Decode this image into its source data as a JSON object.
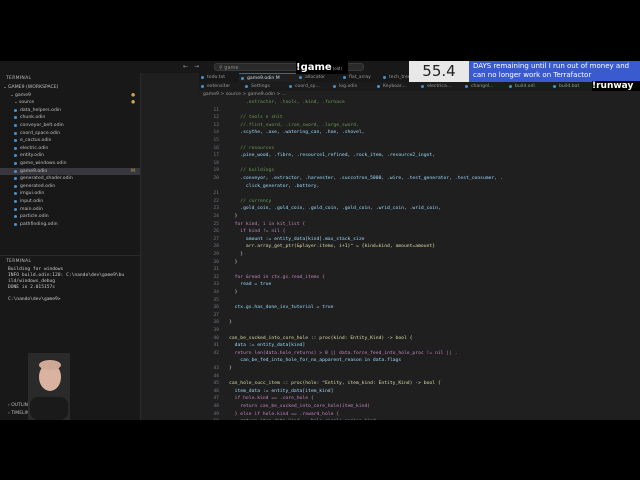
{
  "titlebar": {
    "search": "game",
    "search_icon": "magnifier-icon"
  },
  "sidebar": {
    "header": "TERMINAL",
    "workspace": "GAME9 (WORKSPACE)",
    "folder": "game9",
    "subfolder": "source",
    "files": [
      {
        "name": "data_helpers.odin",
        "mod": ""
      },
      {
        "name": "chunk.odin",
        "mod": ""
      },
      {
        "name": "conveyor_belt.odin",
        "mod": ""
      },
      {
        "name": "coord_space.odin",
        "mod": ""
      },
      {
        "name": "e_cactus.odin",
        "mod": ""
      },
      {
        "name": "electric.odin",
        "mod": ""
      },
      {
        "name": "entity.odin",
        "mod": ""
      },
      {
        "name": "game_windows.odin",
        "mod": ""
      },
      {
        "name": "game9.odin",
        "mod": "M"
      },
      {
        "name": "generated_shader.odin",
        "mod": ""
      },
      {
        "name": "generated.odin",
        "mod": ""
      },
      {
        "name": "imgui.odin",
        "mod": ""
      },
      {
        "name": "input.odin",
        "mod": ""
      },
      {
        "name": "main.odin",
        "mod": ""
      },
      {
        "name": "particle.odin",
        "mod": ""
      },
      {
        "name": "pathfinding.odin",
        "mod": ""
      }
    ],
    "folder_mod": "M",
    "subfolder_mod": "M"
  },
  "terminal": {
    "title": "TERMINAL",
    "lines": [
      "Building for windows",
      "INFO build.odin:120: C:\\nando\\dev\\game9\\bu",
      "ild/windows_debug",
      "DONE in 2.015157s",
      "",
      "C:\\nando\\dev\\game9>"
    ]
  },
  "bottom": {
    "outline": "OUTLINE",
    "timeline": "TIMELINE"
  },
  "tabs": [
    {
      "label": "todo.txt"
    },
    {
      "label": "game9.odin M",
      "active": true
    },
    {
      "label": "allocator"
    },
    {
      "label": "flat_array"
    },
    {
      "label": "tech_tree.odin M"
    },
    {
      "label": "ui.odin"
    },
    {
      "label": "main.odin"
    }
  ],
  "tabs2": [
    {
      "label": "extensiter"
    },
    {
      "label": "Settings"
    },
    {
      "label": "coord_sp..."
    },
    {
      "label": "log.odin"
    },
    {
      "label": "Keyboar..."
    },
    {
      "label": "electrica..."
    },
    {
      "label": "changel..."
    },
    {
      "label": "build.odi"
    },
    {
      "label": "build.bat"
    },
    {
      "label": "generate..."
    }
  ],
  "breadcrumb": "game9 > source > game9.odin > ...",
  "code": [
    {
      "n": "",
      "txt": "      .extractor, .tools, .kind, .furnace",
      "cls": "c"
    },
    {
      "n": "11",
      "txt": "",
      "cls": "s"
    },
    {
      "n": "12",
      "txt": "    // tools n shit",
      "cls": "c"
    },
    {
      "n": "13",
      "txt": "    //.flint_sword, .iron_sword, .large_sword,",
      "cls": "c"
    },
    {
      "n": "14",
      "txt": "    .scythe, .axe, .watering_can, .hoe, .shovel,",
      "cls": "v"
    },
    {
      "n": "15",
      "txt": "",
      "cls": "s"
    },
    {
      "n": "16",
      "txt": "    // resources",
      "cls": "c"
    },
    {
      "n": "17",
      "txt": "    .pine_wood, .fibre, .resource1_refined, .rock_item, .resource2_ingot,",
      "cls": "v"
    },
    {
      "n": "18",
      "txt": "",
      "cls": "s"
    },
    {
      "n": "19",
      "txt": "    // buildings",
      "cls": "c"
    },
    {
      "n": "20",
      "txt": "    .conveyor, .extractor, .harvester, .succotron_5000, .wire, .test_generator, .test_consumer, .",
      "cls": "v"
    },
    {
      "n": "",
      "txt": "      click_generator, .battery,",
      "cls": "v"
    },
    {
      "n": "21",
      "txt": "",
      "cls": "s"
    },
    {
      "n": "22",
      "txt": "    // currency",
      "cls": "c"
    },
    {
      "n": "23",
      "txt": "    .gold_coin, .gold_coin, .gold_coin, .gold_coin, .wrid_coin, .wrid_coin,",
      "cls": "v"
    },
    {
      "n": "24",
      "txt": "  }",
      "cls": "s"
    },
    {
      "n": "25",
      "txt": "  for kind, i in kit_list {",
      "cls": "k"
    },
    {
      "n": "26",
      "txt": "    if kind != nil {",
      "cls": "k"
    },
    {
      "n": "27",
      "txt": "      amount := entity_data[kind].max_stack_size",
      "cls": "v"
    },
    {
      "n": "28",
      "txt": "      arr.array_get_ptr(&player.items, i+1)^ = {kind=kind, amount=amount}",
      "cls": "f"
    },
    {
      "n": "29",
      "txt": "    }",
      "cls": "s"
    },
    {
      "n": "30",
      "txt": "  }",
      "cls": "s"
    },
    {
      "n": "31",
      "txt": "",
      "cls": "s"
    },
    {
      "n": "32",
      "txt": "  for &read in ctx.gs.read_items {",
      "cls": "k"
    },
    {
      "n": "33",
      "txt": "    read = true",
      "cls": "v"
    },
    {
      "n": "34",
      "txt": "  }",
      "cls": "s"
    },
    {
      "n": "35",
      "txt": "",
      "cls": "s"
    },
    {
      "n": "36",
      "txt": "  ctx.gs.has_done_inv_tutorial = true",
      "cls": "v"
    },
    {
      "n": "37",
      "txt": "",
      "cls": "s"
    },
    {
      "n": "38",
      "txt": "}",
      "cls": "s"
    },
    {
      "n": "39",
      "txt": "",
      "cls": "s"
    },
    {
      "n": "40",
      "txt": "can_be_sucked_into_core_hole :: proc(kind: Entity_Kind) -> bool {",
      "cls": "f"
    },
    {
      "n": "41",
      "txt": "  data := entity_data[kind]",
      "cls": "v"
    },
    {
      "n": "42",
      "txt": "  return len(data.hole_returns) > 0 || data.force_feed_into_hole_proc != nil || .",
      "cls": "k"
    },
    {
      "n": "",
      "txt": "    can_be_fed_into_hole_for_no_apparent_reason in data.flags",
      "cls": "v"
    },
    {
      "n": "43",
      "txt": "}",
      "cls": "s"
    },
    {
      "n": "44",
      "txt": "",
      "cls": "s"
    },
    {
      "n": "45",
      "txt": "can_hole_succ_item :: proc(hole: ^Entity, item_kind: Entity_Kind) -> bool {",
      "cls": "f"
    },
    {
      "n": "46",
      "txt": "  item_data := entity_data[item_kind]",
      "cls": "v"
    },
    {
      "n": "47",
      "txt": "  if hole.kind == .core_hole {",
      "cls": "k"
    },
    {
      "n": "48",
      "txt": "    return can_be_sucked_into_core_hole(item_kind)",
      "cls": "k"
    },
    {
      "n": "49",
      "txt": "  } else if hole.kind == .reward_hole {",
      "cls": "k"
    },
    {
      "n": "50",
      "txt": "    return item_data.kind == hole.circle_engine_kind",
      "cls": "k"
    }
  ],
  "overlay": {
    "game_label": "game",
    "game_suffix": "(old)"
  },
  "countdown": {
    "number": "55.4",
    "text": "DAYS remaining until I run out of money and can no longer work on Terrafactor"
  },
  "brand": "runway",
  "colors": {
    "accent": "#0078d4",
    "countdown_bg": "#3a5bd0"
  }
}
